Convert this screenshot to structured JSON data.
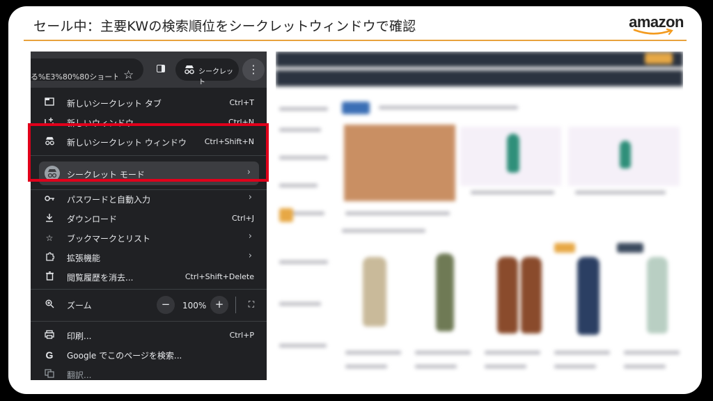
{
  "slide": {
    "title": "セール中：主要KWの検索順位をシークレットウィンドウで確認",
    "brand": "amazon"
  },
  "chrome": {
    "url_text": "る%E3%80%80ショート...",
    "incognito_label": "シークレット",
    "icons": {
      "star": "bookmark-star-icon",
      "side_panel": "side-panel-icon",
      "incognito": "incognito-icon",
      "more": "more-vert-icon"
    },
    "menu": {
      "new_incognito_tab": {
        "label": "新しいシークレット タブ",
        "shortcut": "Ctrl+T"
      },
      "new_window": {
        "label": "新しいウィンドウ",
        "shortcut": "Ctrl+N"
      },
      "new_incognito_window": {
        "label": "新しいシークレット ウィンドウ",
        "shortcut": "Ctrl+Shift+N"
      },
      "incognito_mode": {
        "label": "シークレット モード"
      },
      "passwords": {
        "label": "パスワードと自動入力"
      },
      "downloads": {
        "label": "ダウンロード",
        "shortcut": "Ctrl+J"
      },
      "bookmarks": {
        "label": "ブックマークとリスト"
      },
      "extensions": {
        "label": "拡張機能"
      },
      "clear_history": {
        "label": "閲覧履歴を消去...",
        "shortcut": "Ctrl+Shift+Delete"
      },
      "zoom": {
        "label": "ズーム",
        "value": "100%",
        "minus": "−",
        "plus": "+"
      },
      "print": {
        "label": "印刷...",
        "shortcut": "Ctrl+P"
      },
      "search_page": {
        "label": "Google でこのページを検索..."
      },
      "translate": {
        "label": "翻訳..."
      }
    }
  },
  "colors": {
    "highlight_border": "#e0001b",
    "title_rule": "#e8a23c",
    "menu_bg": "#202124"
  }
}
